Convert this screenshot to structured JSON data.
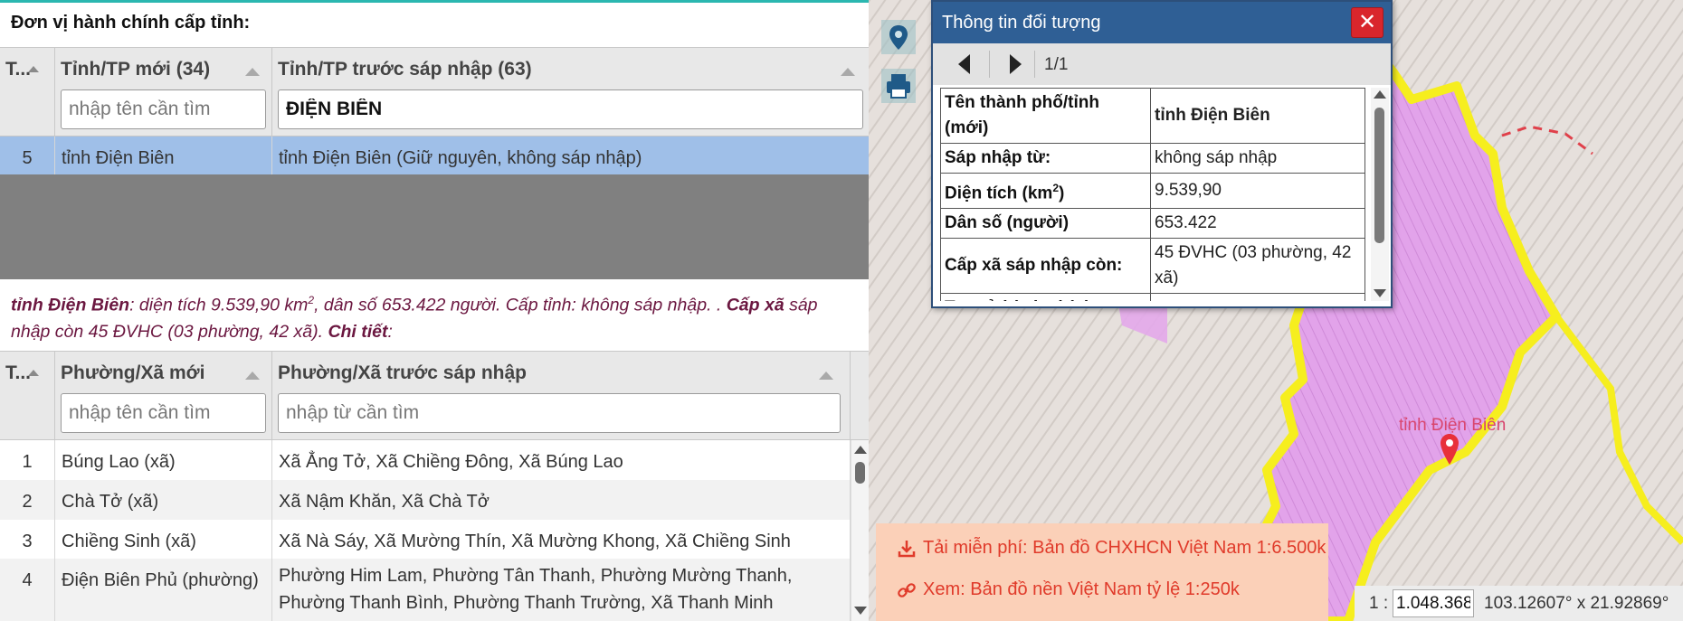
{
  "panel": {
    "title": "Đơn vị hành chính cấp tỉnh:"
  },
  "province_grid": {
    "columns": [
      {
        "label": "T..."
      },
      {
        "label": "Tỉnh/TP mới (34)",
        "placeholder": "nhập tên cần tìm",
        "value": ""
      },
      {
        "label": "Tỉnh/TP trước sáp nhập (63)",
        "placeholder": "",
        "value": "ĐIỆN BIÊN"
      }
    ],
    "rows": [
      {
        "num": "5",
        "new": "tỉnh Điện Biên",
        "old": "tỉnh Điện Biên (Giữ nguyên, không sáp nhập)"
      }
    ]
  },
  "summary": {
    "name": "tỉnh Điện Biên",
    "part1": ": diện tích 9.539,90 km",
    "sup": "2",
    "part2": ", dân số 653.422 người. Cấp tỉnh: không sáp nhập. . ",
    "commune_label": "Cấp xã",
    "part3": " sáp nhập còn 45 ĐVHC (03 phường, 42 xã). ",
    "detail_label": "Chi tiết",
    "part4": ":"
  },
  "commune_grid": {
    "columns": [
      {
        "label": "T..."
      },
      {
        "label": "Phường/Xã mới",
        "placeholder": "nhập tên cần tìm"
      },
      {
        "label": "Phường/Xã trước sáp nhập",
        "placeholder": "nhập từ cần tìm"
      }
    ],
    "rows": [
      {
        "num": "1",
        "new": "Búng Lao (xã)",
        "old": "Xã Ẳng Tở, Xã Chiềng Đông, Xã Búng Lao"
      },
      {
        "num": "2",
        "new": "Chà Tở (xã)",
        "old": "Xã Nậm Khăn, Xã Chà Tở"
      },
      {
        "num": "3",
        "new": "Chiềng Sinh (xã)",
        "old": "Xã Nà Sáy, Xã Mường Thín, Xã Mường Khong, Xã Chiềng Sinh"
      },
      {
        "num": "4",
        "new": "Điện Biên Phủ (phường)",
        "old": "Phường Him Lam, Phường Tân Thanh, Phường Mường Thanh, Phường Thanh Bình, Phường Thanh Trường, Xã Thanh Minh"
      }
    ]
  },
  "map": {
    "province_label": "tỉnh Điện Biên",
    "tools": [
      "location-pin-icon",
      "print-icon"
    ],
    "colors": {
      "province_fill": "#e6a6ee",
      "border": "#f5ee1f",
      "marker": "#e8303a"
    }
  },
  "popup": {
    "title": "Thông tin đối tượng",
    "close": "✕",
    "page": "1/1",
    "fields": [
      {
        "key": "Tên thành phố/tỉnh (mới)",
        "value": "tỉnh Điện Biên"
      },
      {
        "key": "Sáp nhập từ:",
        "value": "không sáp nhập"
      },
      {
        "key": "Diện tích (km",
        "key_sup": "2",
        "key_end": ")",
        "value": "9.539,90"
      },
      {
        "key": "Dân số (người)",
        "value": "653.422"
      },
      {
        "key": "Cấp xã sáp nhập còn:",
        "value": "45 ĐVHC (03 phường, 42 xã)"
      },
      {
        "key": "Trụ sở hành chính",
        "value": "..."
      }
    ]
  },
  "downloads": [
    {
      "icon": "download-icon",
      "label": "Tải miễn phí: Bản đồ CHXHCN Việt Nam 1:6.500k"
    },
    {
      "icon": "link-icon",
      "label": "Xem: Bản đồ nền Việt Nam tỷ lệ 1:250k"
    }
  ],
  "scale": {
    "prefix": "1 :",
    "value": "1.048.368",
    "coords": "103.12607° x 21.92869°"
  }
}
